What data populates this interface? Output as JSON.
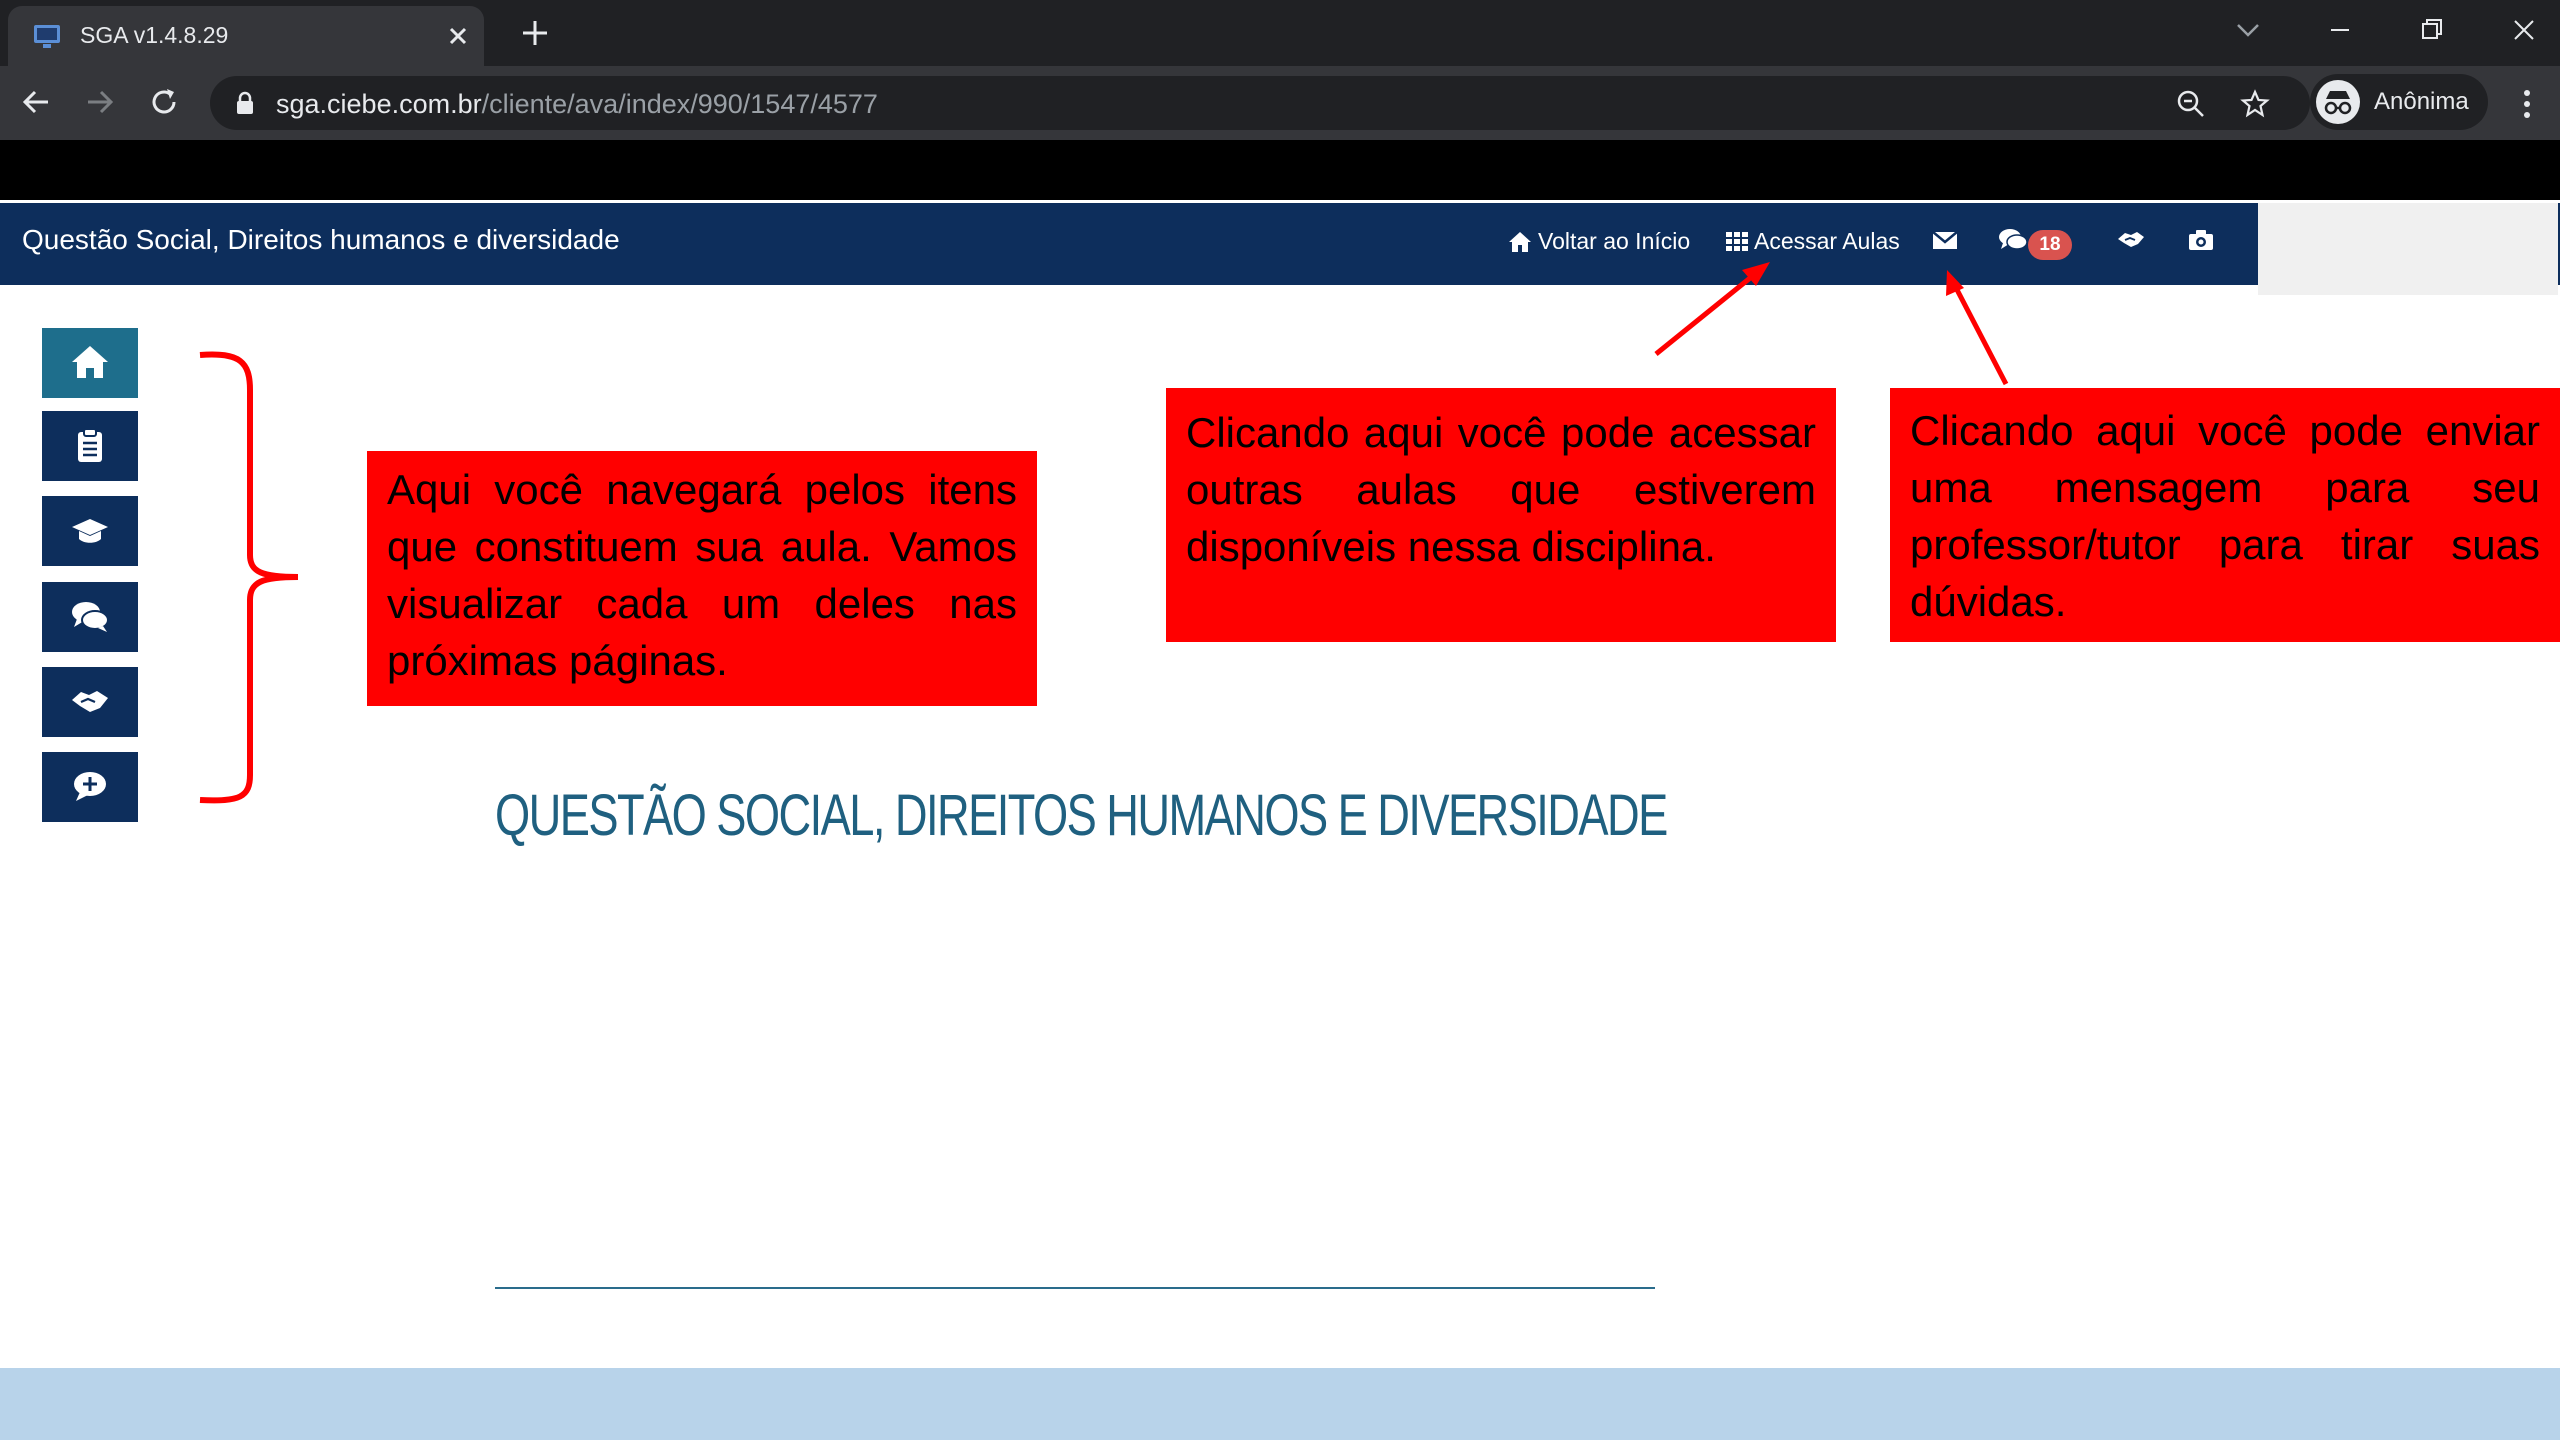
{
  "browser": {
    "tab_title": "SGA v1.4.8.29",
    "url_host": "sga.ciebe.com.br",
    "url_path": "/cliente/ava/index/990/1547/4577",
    "profile_label": "Anônima"
  },
  "navbar": {
    "course_title": "Questão Social, Direitos humanos e diversidade",
    "home_label": "Voltar ao Início",
    "classes_label": "Acessar Aulas",
    "chat_badge": "18"
  },
  "side_menu": {
    "items": [
      "home-icon",
      "clipboard-icon",
      "graduation-cap-icon",
      "comments-icon",
      "handshake-icon",
      "comment-plus-icon"
    ]
  },
  "annotations": {
    "left": "Aqui você navegará pelos itens que constituem sua aula. Vamos visualizar cada um deles nas próximas páginas.",
    "middle": "Clicando aqui você pode acessar outras aulas que estiverem disponíveis nessa disciplina.",
    "right": "Clicando aqui você pode enviar uma mensagem para seu professor/tutor para tirar suas dúvidas."
  },
  "content": {
    "heading": "QUESTÃO SOCIAL, DIREITOS HUMANOS E DIVERSIDADE"
  },
  "colors": {
    "navbar": "#0d2e5c",
    "annotation": "#ff0000",
    "heading": "#1f6080",
    "footer": "#b8d3ea"
  }
}
